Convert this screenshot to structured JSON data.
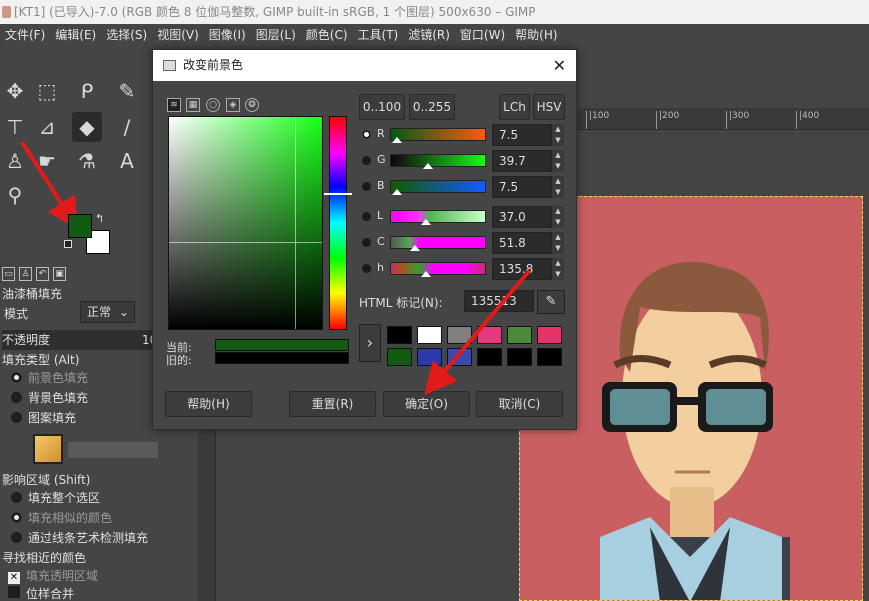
{
  "window": {
    "title": "[KT1] (已导入)-7.0 (RGB 颜色 8 位伽马整数, GIMP built-in sRGB, 1 个图层) 500x630 – GIMP"
  },
  "menu": [
    "文件(F)",
    "编辑(E)",
    "选择(S)",
    "视图(V)",
    "图像(I)",
    "图层(L)",
    "颜色(C)",
    "工具(T)",
    "滤镜(R)",
    "窗口(W)",
    "帮助(H)"
  ],
  "toolbox": {
    "tools": [
      {
        "name": "move-tool-icon",
        "glyph": "✥"
      },
      {
        "name": "rect-select-tool-icon",
        "glyph": "⬚"
      },
      {
        "name": "lasso-tool-icon",
        "glyph": "ᑭ"
      },
      {
        "name": "fuzzy-select-tool-icon",
        "glyph": "✎"
      },
      {
        "name": "transform-tool-icon",
        "glyph": "⊤"
      },
      {
        "name": "warp-tool-icon",
        "glyph": "⊿"
      },
      {
        "name": "bucket-fill-tool-icon",
        "glyph": "◆"
      },
      {
        "name": "paintbrush-tool-icon",
        "glyph": "∕"
      },
      {
        "name": "clone-tool-icon",
        "glyph": "♙"
      },
      {
        "name": "smudge-tool-icon",
        "glyph": "☛"
      },
      {
        "name": "color-picker-tool-icon",
        "glyph": "⚗"
      },
      {
        "name": "text-tool-icon",
        "glyph": "A"
      },
      {
        "name": "zoom-tool-icon",
        "glyph": "⚲"
      }
    ],
    "fg_color": "#135a13",
    "bg_color": "#ffffff"
  },
  "options": {
    "title": "油漆桶填充",
    "mode_label": "模式",
    "mode_value": "正常",
    "opacity_label": "不透明度",
    "opacity_value": "10",
    "fill_type_label": "填充类型 (Alt)",
    "fill_fg": "前景色填充",
    "fill_bg": "背景色填充",
    "fill_pattern": "图案填充",
    "affected_label": "影响区域 (Shift)",
    "area_selection": "填充整个选区",
    "area_similar": "填充相似的颜色",
    "area_line_art": "通过线条艺术检测填充",
    "find_similar_label": "寻找相近的颜色",
    "fill_transparent": "填充透明区域",
    "sample_merged": "位样合并"
  },
  "ruler": [
    "|100",
    "|200",
    "|300",
    "|400"
  ],
  "dialog": {
    "title": "改变前景色",
    "close": "✕",
    "range_0_100": "0..100",
    "range_0_255": "0..255",
    "lch": "LCh",
    "hsv": "HSV",
    "channels": [
      {
        "label": "R",
        "value": "7.5",
        "gradient": "linear-gradient(to right,#005a13,#ff5a13)",
        "marker": 0.075,
        "selected": true
      },
      {
        "label": "G",
        "value": "39.7",
        "gradient": "linear-gradient(to right,#130013,#13ff13)",
        "marker": 0.397,
        "selected": false
      },
      {
        "label": "B",
        "value": "7.5",
        "gradient": "linear-gradient(to right,#135a00,#135aff)",
        "marker": 0.075,
        "selected": false
      },
      {
        "label": "L",
        "value": "37.0",
        "gradient": "linear-gradient(to right,#ff00ff,#ff33ff 30%,#4fb34f 40%,#ccffcc)",
        "marker": 0.37,
        "selected": false
      },
      {
        "label": "C",
        "value": "51.8",
        "gradient": "linear-gradient(to right,#555,#55aa55 20%,#ff00ff 30%,#ff00ff)",
        "marker": 0.26,
        "selected": false
      },
      {
        "label": "h",
        "value": "135.8",
        "gradient": "linear-gradient(to right,#c03070,#b05020 10%,#30a030 30%,#ff00ff 45%,#ff00ff 80%,#c03070)",
        "marker": 0.377,
        "selected": false
      }
    ],
    "html_label": "HTML 标记(N):",
    "html_value": "135513",
    "current_label": "当前:",
    "old_label": "旧的:",
    "current_color": "#135a13",
    "old_color": "#000000",
    "history": [
      "#000000",
      "#ffffff",
      "#808080",
      "#e63a80",
      "#4a8a3a",
      "#e6336a",
      "#135a13",
      "#2a3aa8",
      "#3a4aaa",
      "#000000",
      "#000000",
      "#000000"
    ],
    "buttons": {
      "help": "帮助(H)",
      "reset": "重置(R)",
      "ok": "确定(O)",
      "cancel": "取消(C)"
    }
  }
}
